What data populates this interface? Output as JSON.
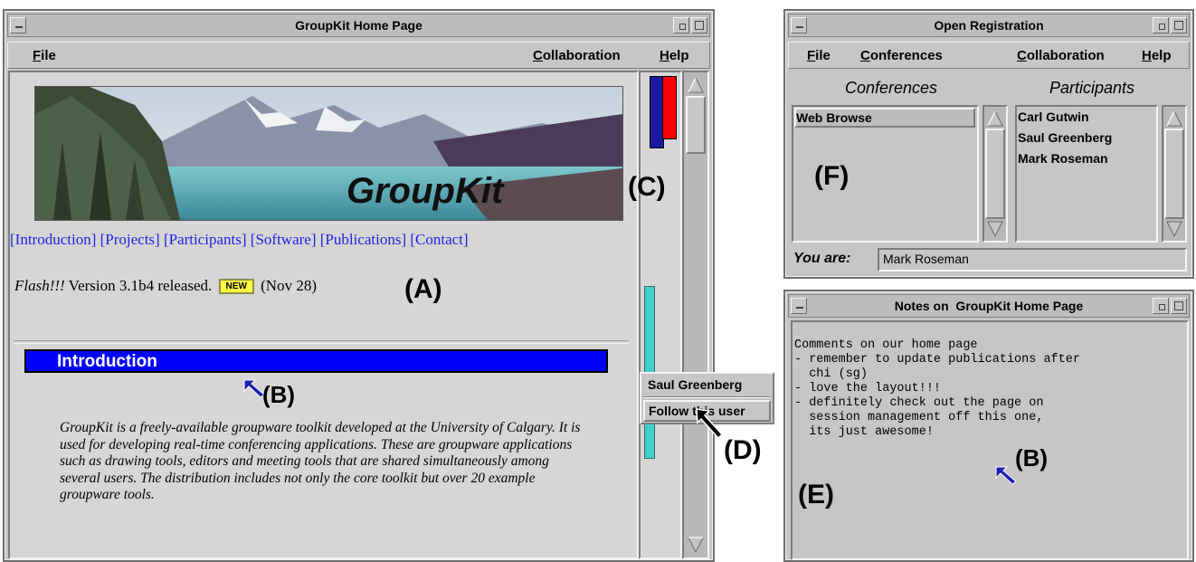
{
  "main_window": {
    "title": "GroupKit Home Page",
    "menu": {
      "file": "File",
      "collaboration": "Collaboration",
      "help": "Help"
    },
    "banner_text": "GroupKit",
    "nav_links": [
      "[Introduction]",
      "[Projects]",
      "[Participants]",
      "[Software]",
      "[Publications]",
      "[Contact]"
    ],
    "flash": {
      "prefix": "Flash!!!",
      "text": "Version 3.1b4 released.",
      "badge": "NEW",
      "date": "(Nov 28)"
    },
    "intro_heading": "Introduction",
    "intro_paragraph": "GroupKit is a freely-available groupware toolkit developed at the University of Calgary. It is used for developing real-time conferencing applications. These are groupware applications such as drawing tools, editors and meeting tools that are shared simultaneously among several users. The distribution includes not only the core toolkit but over 20 example groupware tools.",
    "popup": {
      "user": "Saul Greenberg",
      "action": "Follow this user"
    }
  },
  "registration_window": {
    "title": "Open Registration",
    "menu": {
      "file": "File",
      "conferences": "Conferences",
      "collaboration": "Collaboration",
      "help": "Help"
    },
    "conferences_header": "Conferences",
    "participants_header": "Participants",
    "conferences": [
      "Web Browse"
    ],
    "participants": [
      "Carl Gutwin",
      "Saul Greenberg",
      "Mark Roseman"
    ],
    "you_are_label": "You are:",
    "you_are_value": "Mark Roseman"
  },
  "notes_window": {
    "title": "Notes on  GroupKit Home Page",
    "lines": [
      "Comments on our home page",
      "- remember to update publications after",
      "  chi (sg)",
      "- love the layout!!!",
      "- definitely check out the page on",
      "  session management off this one,",
      "  its just awesome!"
    ]
  },
  "annotations": {
    "a": "(A)",
    "b": "(B)",
    "c": "(C)",
    "d": "(D)",
    "e": "(E)",
    "f": "(F)"
  },
  "colors": {
    "link": "#1f1fe8",
    "heading_bar": "#0000ff",
    "telepointer": "#2020b0",
    "overview_teal": "#40d0c8",
    "overview_red": "#ff0000",
    "overview_blue": "#1a1aa0"
  }
}
